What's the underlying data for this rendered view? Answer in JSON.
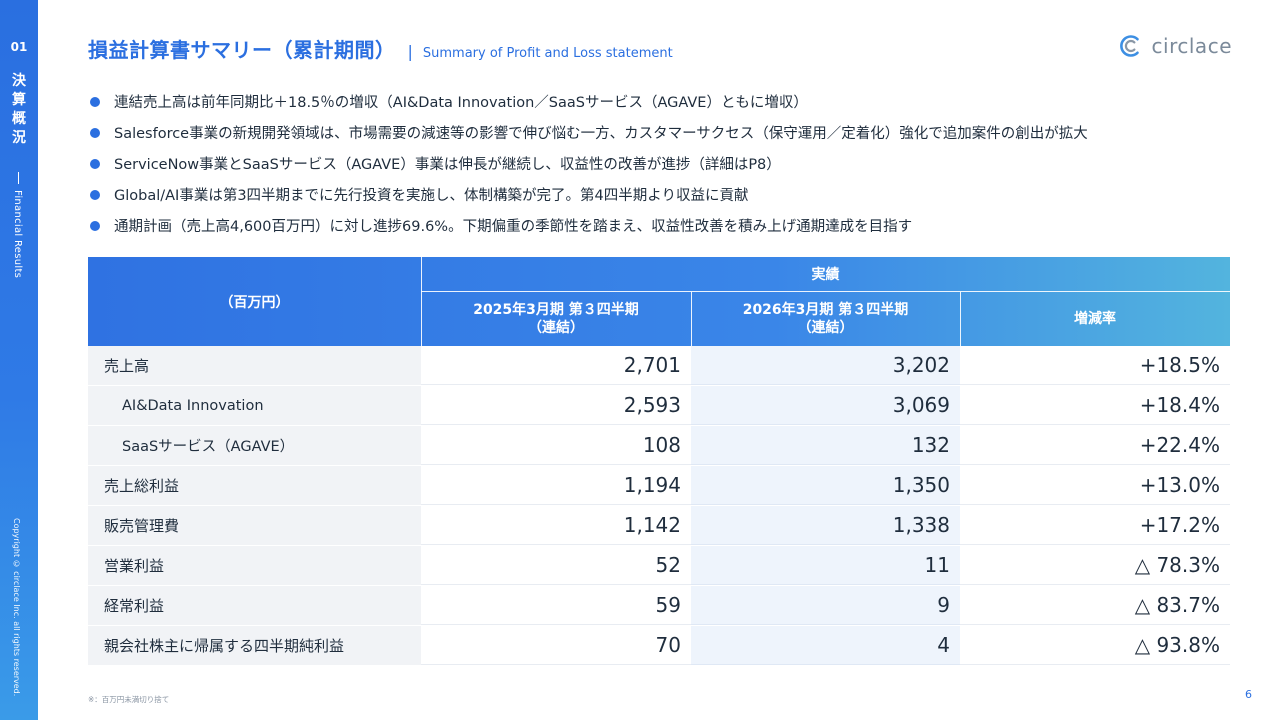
{
  "sidebar": {
    "section_number": "01",
    "section_jp_chars": [
      "決",
      "算",
      "概",
      "況"
    ],
    "section_en": "Financial Results",
    "copyright": "Copyright © circlace Inc. all rights reserved."
  },
  "header": {
    "title_jp": "損益計算書サマリー（累計期間）",
    "title_en": "Summary of Profit and Loss statement",
    "logo_text": "circlace"
  },
  "bullets": [
    "連結売上高は前年同期比＋18.5％の増収（AI&Data Innovation／SaaSサービス（AGAVE）ともに増収）",
    "Salesforce事業の新規開発領域は、市場需要の減速等の影響で伸び悩む一方、カスタマーサクセス（保守運用／定着化）強化で追加案件の創出が拡大",
    "ServiceNow事業とSaaSサービス（AGAVE）事業は伸長が継続し、収益性の改善が進捗（詳細はP8）",
    "Global/AI事業は第3四半期までに先行投資を実施し、体制構築が完了。第4四半期より収益に貢献",
    "通期計画（売上高4,600百万円）に対し進捗69.6%。下期偏重の季節性を踏まえ、収益性改善を積み上げ通期達成を目指す"
  ],
  "table": {
    "unit_label": "（百万円）",
    "group_label": "実績",
    "columns": [
      {
        "line1": "2025年3月期 第３四半期",
        "line2": "（連結）"
      },
      {
        "line1": "2026年3月期 第３四半期",
        "line2": "（連結）"
      },
      {
        "line1": "増減率",
        "line2": ""
      }
    ],
    "rows": [
      {
        "label": "売上高",
        "indent": false,
        "prev": "2,701",
        "curr": "3,202",
        "rate": "+18.5%"
      },
      {
        "label": "AI&Data Innovation",
        "indent": true,
        "prev": "2,593",
        "curr": "3,069",
        "rate": "+18.4%"
      },
      {
        "label": "SaaSサービス（AGAVE）",
        "indent": true,
        "prev": "108",
        "curr": "132",
        "rate": "+22.4%"
      },
      {
        "label": "売上総利益",
        "indent": false,
        "prev": "1,194",
        "curr": "1,350",
        "rate": "+13.0%"
      },
      {
        "label": "販売管理費",
        "indent": false,
        "prev": "1,142",
        "curr": "1,338",
        "rate": "+17.2%"
      },
      {
        "label": "営業利益",
        "indent": false,
        "prev": "52",
        "curr": "11",
        "rate": "△ 78.3%"
      },
      {
        "label": "経常利益",
        "indent": false,
        "prev": "59",
        "curr": "9",
        "rate": "△ 83.7%"
      },
      {
        "label": "親会社株主に帰属する四半期純利益",
        "indent": false,
        "prev": "70",
        "curr": "4",
        "rate": "△ 93.8%"
      }
    ]
  },
  "footer": {
    "note": "※：百万円未満切り捨て",
    "page_number": "6"
  },
  "colors": {
    "accent": "#2b6fe0",
    "header_gradient_end": "#53b4de",
    "label_bg": "#f1f3f6",
    "current_col_bg": "#eef4fc"
  }
}
